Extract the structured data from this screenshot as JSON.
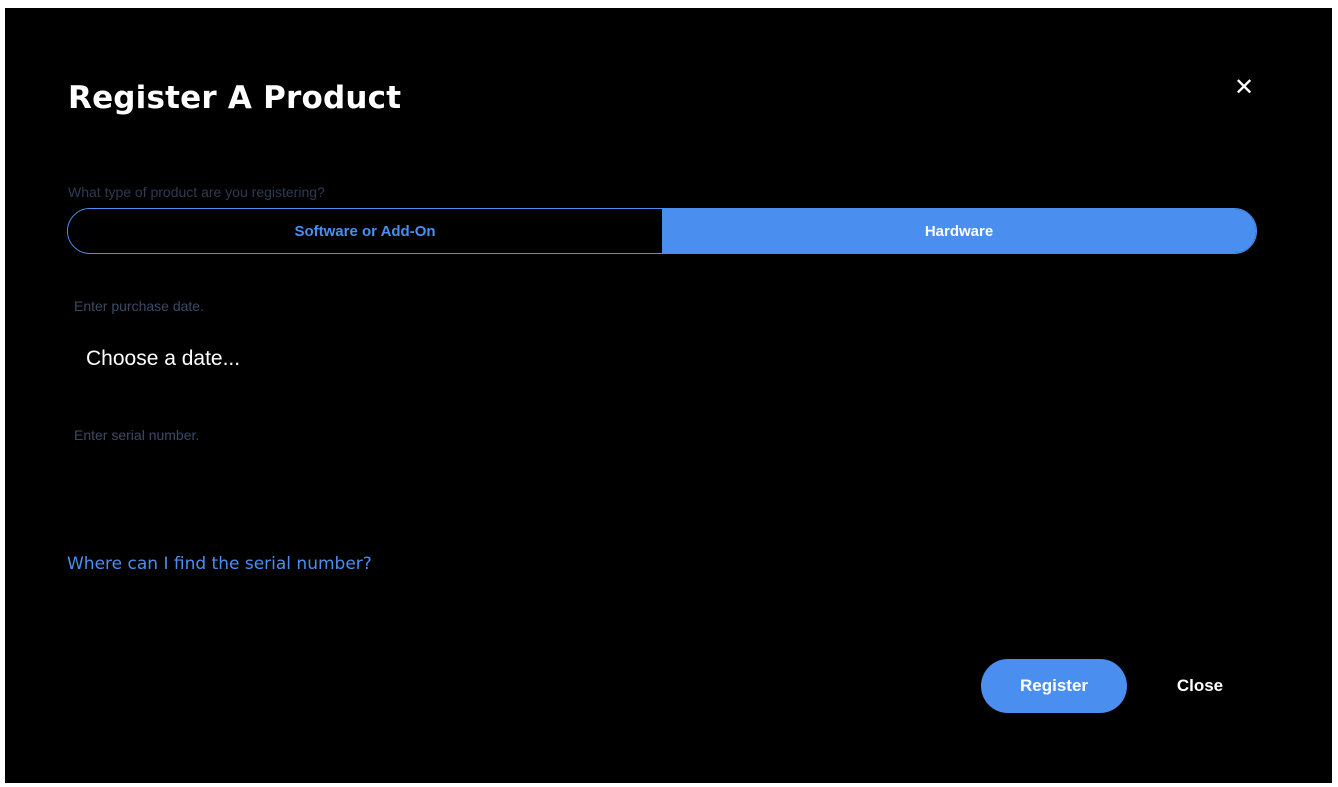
{
  "dialog": {
    "title": "Register A Product",
    "close_icon": "close-icon",
    "close_glyph": "✕"
  },
  "product_type": {
    "label": "What type of product are you registering?",
    "options": [
      {
        "label": "Software or Add-On",
        "selected": false
      },
      {
        "label": "Hardware",
        "selected": true
      }
    ]
  },
  "purchase_date": {
    "label": "Enter purchase date.",
    "placeholder": "Choose a date..."
  },
  "serial_number": {
    "placeholder": "Enter serial number."
  },
  "help_link": {
    "text": "Where can I find the serial number?"
  },
  "footer": {
    "register_label": "Register",
    "close_label": "Close"
  },
  "colors": {
    "background": "#000000",
    "accent": "#4a8ff0",
    "muted_text": "#3a4a64",
    "text": "#ffffff"
  }
}
